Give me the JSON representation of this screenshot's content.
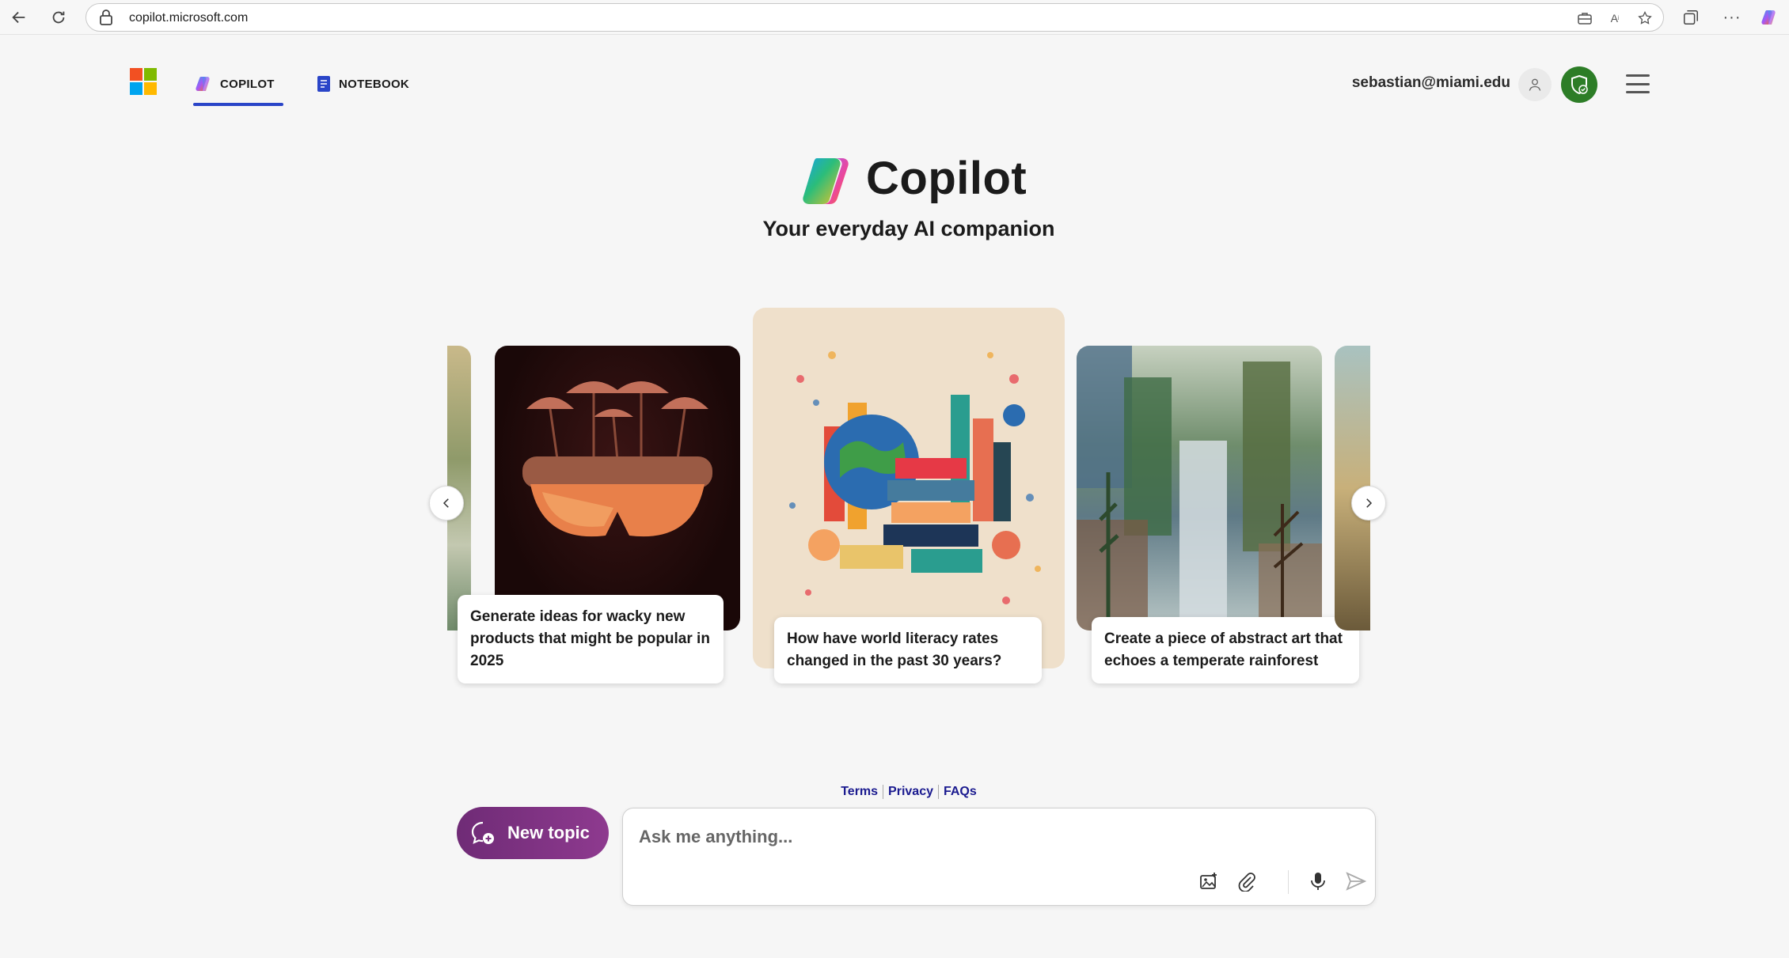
{
  "browser": {
    "url": "copilot.microsoft.com"
  },
  "header": {
    "tabs": [
      {
        "label": "COPILOT"
      },
      {
        "label": "NOTEBOOK"
      }
    ],
    "user_email": "sebastian@miami.edu"
  },
  "hero": {
    "title": "Copilot",
    "subtitle": "Your everyday AI companion"
  },
  "carousel": {
    "cards": [
      {
        "caption": "Generate ideas for wacky new products that might be popular in 2025"
      },
      {
        "caption": "How have world literacy rates changed in the past 30 years?"
      },
      {
        "caption": "Create a piece of abstract art that echoes a temperate rainforest"
      }
    ]
  },
  "footer": {
    "links": [
      "Terms",
      "Privacy",
      "FAQs"
    ]
  },
  "composer": {
    "new_topic_label": "New topic",
    "placeholder": "Ask me anything..."
  },
  "colors": {
    "accent": "#2a45c8",
    "new_topic": "#7b2f80",
    "shield": "#2d7d27",
    "link": "#1a1a8f"
  }
}
